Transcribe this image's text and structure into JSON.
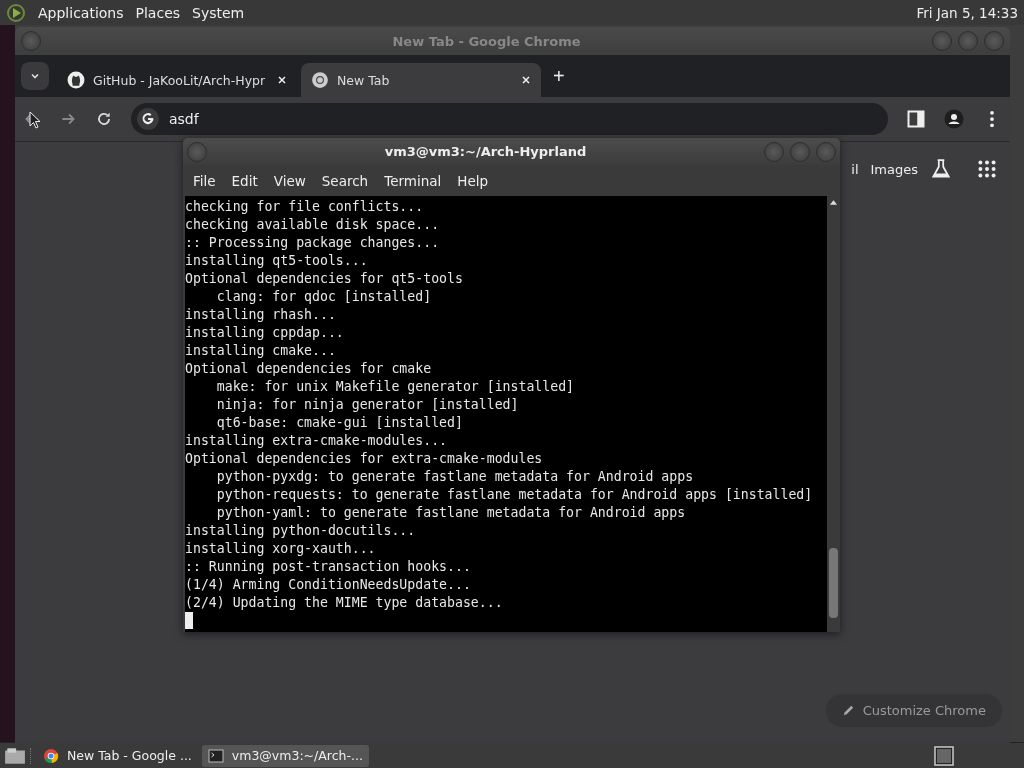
{
  "top_panel": {
    "menus": [
      "Applications",
      "Places",
      "System"
    ],
    "clock": "Fri Jan  5, 14:33"
  },
  "browser": {
    "title": "New Tab - Google Chrome",
    "tabs": [
      {
        "label": "GitHub - JaKooLit/Arch-Hypr",
        "kind": "github",
        "selected": false
      },
      {
        "label": "New Tab",
        "kind": "chrome",
        "selected": true
      }
    ],
    "new_tab": "+",
    "address": "asdf",
    "links": [
      "il",
      "Images"
    ],
    "customize": "Customize Chrome"
  },
  "terminal": {
    "title": "vm3@vm3:~/Arch-Hyprland",
    "menus": [
      "File",
      "Edit",
      "View",
      "Search",
      "Terminal",
      "Help"
    ],
    "lines": [
      "checking for file conflicts...",
      "checking available disk space...",
      ":: Processing package changes...",
      "installing qt5-tools...",
      "Optional dependencies for qt5-tools",
      "    clang: for qdoc [installed]",
      "installing rhash...",
      "installing cppdap...",
      "installing cmake...",
      "Optional dependencies for cmake",
      "    make: for unix Makefile generator [installed]",
      "    ninja: for ninja generator [installed]",
      "    qt6-base: cmake-gui [installed]",
      "installing extra-cmake-modules...",
      "Optional dependencies for extra-cmake-modules",
      "    python-pyxdg: to generate fastlane metadata for Android apps",
      "    python-requests: to generate fastlane metadata for Android apps [installed]",
      "    python-yaml: to generate fastlane metadata for Android apps",
      "installing python-docutils...",
      "installing xorg-xauth...",
      ":: Running post-transaction hooks...",
      "(1/4) Arming ConditionNeedsUpdate...",
      "(2/4) Updating the MIME type database..."
    ]
  },
  "taskbar": [
    {
      "label": "New Tab - Google ...",
      "kind": "chrome",
      "selected": false
    },
    {
      "label": "vm3@vm3:~/Arch-...",
      "kind": "terminal",
      "selected": true
    }
  ]
}
